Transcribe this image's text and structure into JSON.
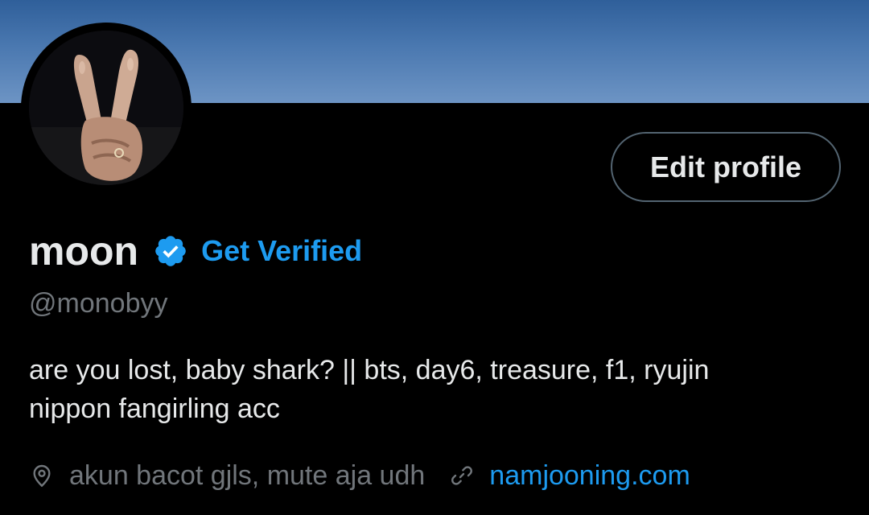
{
  "profile": {
    "display_name": "moon",
    "verified_icon": "verified-badge-icon",
    "get_verified_label": "Get Verified",
    "handle": "@monobyy",
    "bio_lines": [
      "are you lost, baby shark? || bts, day6, treasure, f1, ryujin",
      "nippon fangirling acc"
    ],
    "location": "akun bacot gjls, mute aja udh",
    "location_icon": "location-pin-icon",
    "website": "namjooning.com",
    "website_icon": "link-icon"
  },
  "actions": {
    "edit_profile_label": "Edit profile"
  },
  "colors": {
    "background": "#000000",
    "text_primary": "#e7e9ea",
    "text_secondary": "#71767b",
    "accent": "#1d9bf0",
    "button_border": "#536471"
  }
}
